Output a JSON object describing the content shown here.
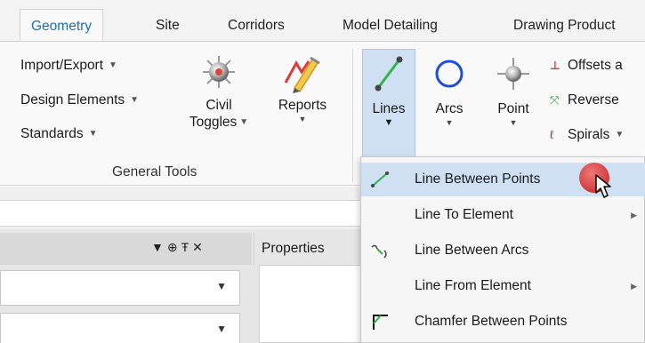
{
  "tabs": [
    {
      "label": "Geometry",
      "active": true
    },
    {
      "label": "Site"
    },
    {
      "label": "Corridors"
    },
    {
      "label": "Model Detailing"
    },
    {
      "label": "Drawing Product"
    }
  ],
  "general_tools": {
    "group_label": "General Tools",
    "small_buttons": [
      "Import/Export",
      "Design Elements",
      "Standards"
    ],
    "civil_toggles": {
      "line1": "Civil",
      "line2": "Toggles"
    },
    "reports": "Reports"
  },
  "horizontal": {
    "lines": "Lines",
    "arcs": "Arcs",
    "point": "Point",
    "small_buttons": [
      "Offsets a",
      "Reverse",
      "Spirals"
    ]
  },
  "panels": {
    "properties_tab": "Properties"
  },
  "lines_menu": {
    "items": [
      {
        "label": "Line Between Points",
        "highlighted": true,
        "has_submenu": false,
        "icon": "line-icon"
      },
      {
        "label": "Line To Element",
        "highlighted": false,
        "has_submenu": true,
        "icon": ""
      },
      {
        "label": "Line Between Arcs",
        "highlighted": false,
        "has_submenu": false,
        "icon": "line-between-arcs-icon"
      },
      {
        "label": "Line From Element",
        "highlighted": false,
        "has_submenu": true,
        "icon": ""
      },
      {
        "label": "Chamfer Between Points",
        "highlighted": false,
        "has_submenu": false,
        "icon": "chamfer-icon"
      }
    ]
  },
  "colors": {
    "accent": "#1f6fb7",
    "highlight": "#cfe0f3",
    "line_green": "#2db34a",
    "cursor_red": "#d03a3a"
  }
}
